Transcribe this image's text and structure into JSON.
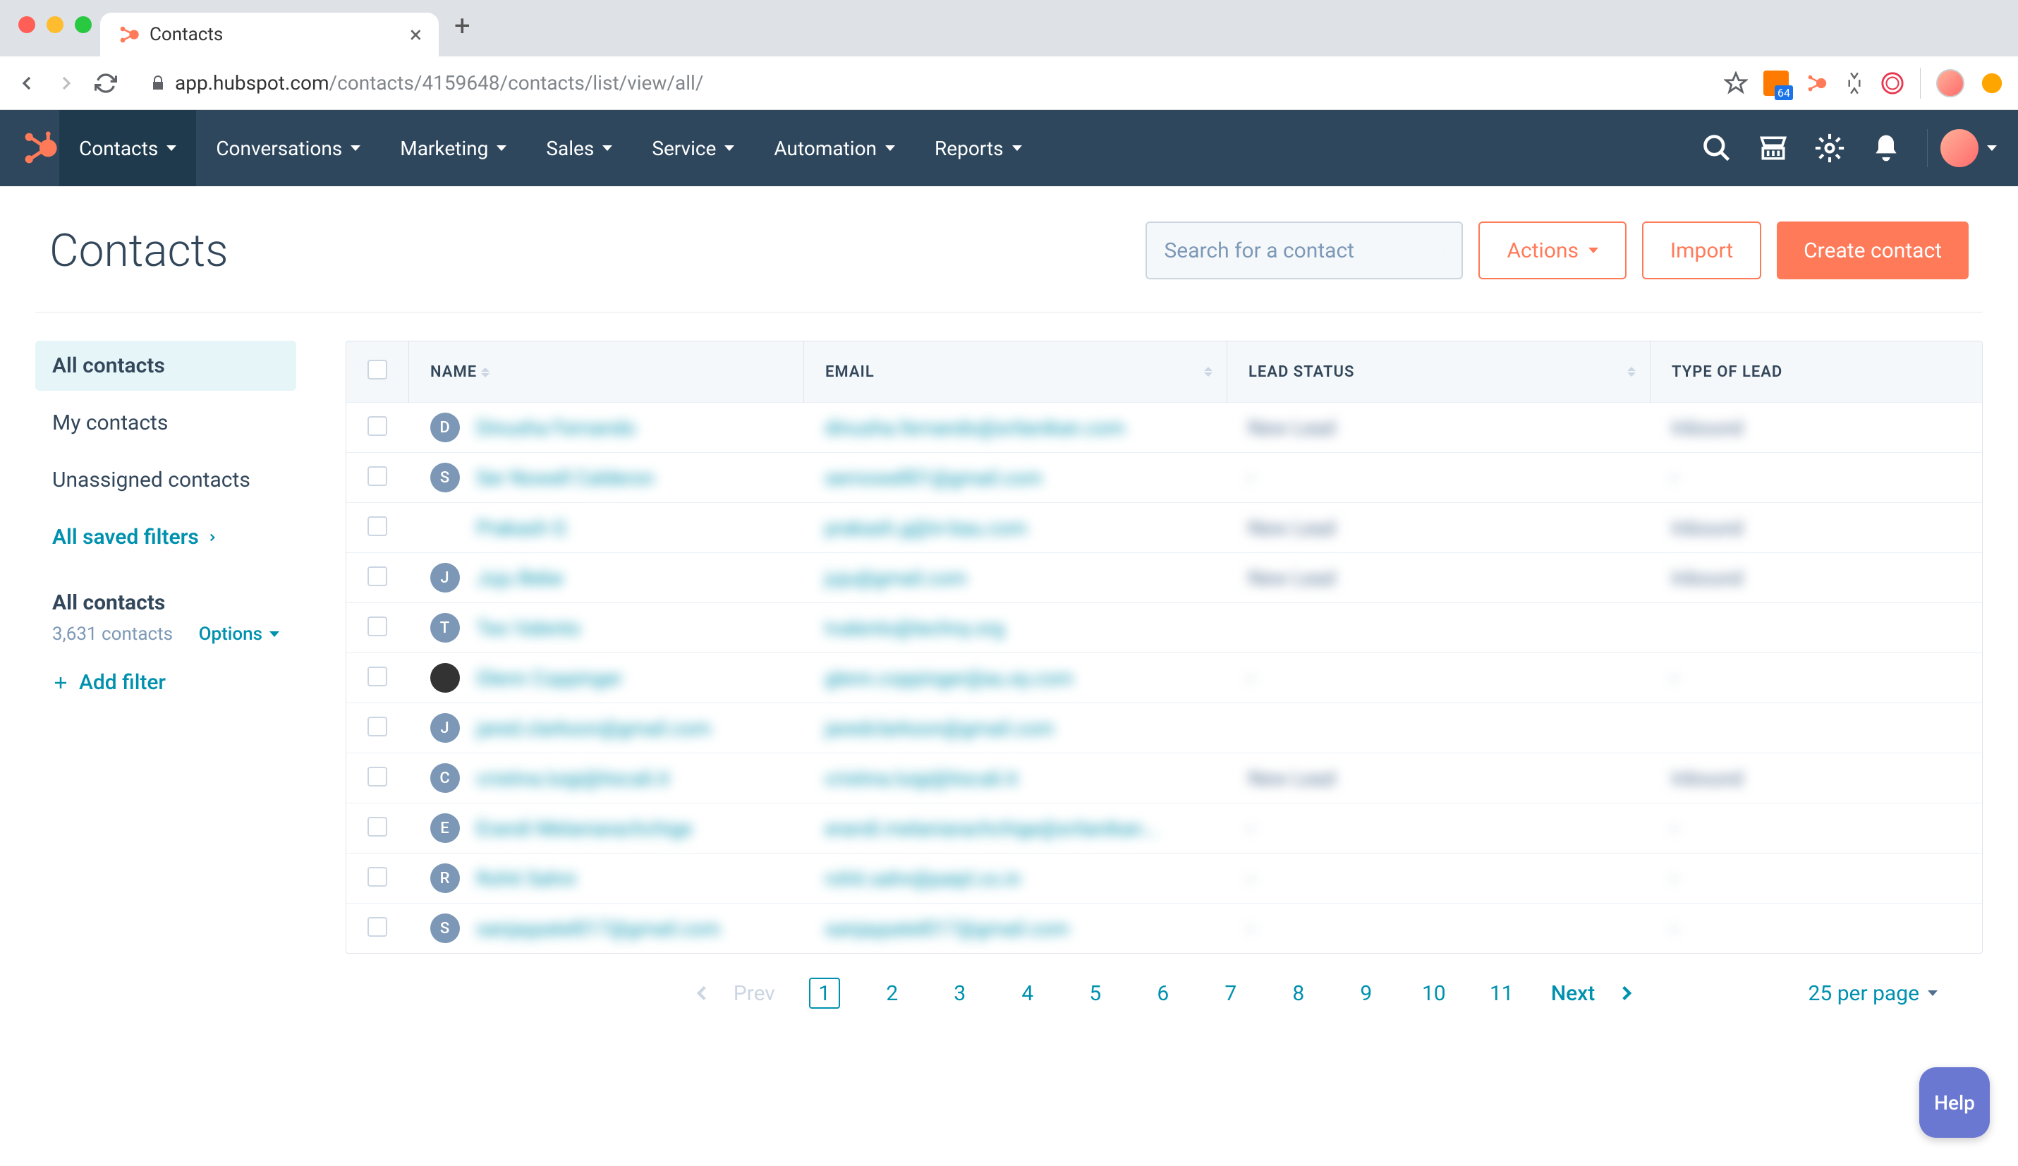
{
  "browser": {
    "tab_title": "Contacts",
    "url_host": "app.hubspot.com",
    "url_path": "/contacts/4159648/contacts/list/view/all/",
    "badge": "64"
  },
  "nav": {
    "items": [
      {
        "label": "Contacts",
        "active": true
      },
      {
        "label": "Conversations"
      },
      {
        "label": "Marketing"
      },
      {
        "label": "Sales"
      },
      {
        "label": "Service"
      },
      {
        "label": "Automation"
      },
      {
        "label": "Reports"
      }
    ]
  },
  "header": {
    "title": "Contacts",
    "search_placeholder": "Search for a contact",
    "actions_label": "Actions",
    "import_label": "Import",
    "create_label": "Create contact"
  },
  "sidebar": {
    "views": [
      {
        "label": "All contacts",
        "active": true
      },
      {
        "label": "My contacts"
      },
      {
        "label": "Unassigned contacts"
      }
    ],
    "saved_filters_label": "All saved filters",
    "current_title": "All contacts",
    "count_text": "3,631 contacts",
    "options_label": "Options",
    "add_filter_label": "Add filter"
  },
  "table": {
    "columns": [
      "NAME",
      "EMAIL",
      "LEAD STATUS",
      "TYPE OF LEAD"
    ],
    "rows": [
      {
        "initial": "D",
        "color": "#7c98b6",
        "name": "Dinusha Fernando",
        "email": "dinusha.fernando@srilanikan.com",
        "status": "New Lead",
        "type": "Inbound"
      },
      {
        "initial": "S",
        "color": "#7c98b6",
        "name": "Ser Nowell Calderon",
        "email": "sernowell01@gmail.com",
        "status": "-",
        "type": "-"
      },
      {
        "initial": "",
        "color": "#fff",
        "name": "Prakash G",
        "email": "prakash.g@in-bau.com",
        "status": "New Lead",
        "type": "Inbound"
      },
      {
        "initial": "J",
        "color": "#7c98b6",
        "name": "Juju Bebe",
        "email": "juju@gmail.com",
        "status": "New Lead",
        "type": "Inbound"
      },
      {
        "initial": "T",
        "color": "#7c98b6",
        "name": "Teo Valento",
        "email": "tvalento@techny.org",
        "status": "",
        "type": ""
      },
      {
        "initial": "",
        "color": "#333",
        "name": "Glenn Coppinger",
        "email": "glenn.coppinger@au.ey.com",
        "status": "-",
        "type": "-"
      },
      {
        "initial": "J",
        "color": "#7c98b6",
        "name": "jared.clarkson@gmail.com",
        "email": "jaredclarkson@gmail.com",
        "status": "",
        "type": ""
      },
      {
        "initial": "C",
        "color": "#7c98b6",
        "name": "cristina.luigi@tiscali.it",
        "email": "cristina.luigi@tiscali.it",
        "status": "New Lead",
        "type": "Inbound"
      },
      {
        "initial": "E",
        "color": "#7c98b6",
        "name": "Erandi Melaniarachchige",
        "email": "erandi.melaniarachchige@srilanikan...",
        "status": "-",
        "type": "-"
      },
      {
        "initial": "R",
        "color": "#7c98b6",
        "name": "Rohit Sahni",
        "email": "rohit.sahn@paipl.co.in",
        "status": "-",
        "type": "-"
      },
      {
        "initial": "S",
        "color": "#7c98b6",
        "name": "sanjaypatel017@gmail.com",
        "email": "sanjaypatel017@gmail.com",
        "status": "-",
        "type": "-"
      }
    ]
  },
  "pagination": {
    "prev": "Prev",
    "next": "Next",
    "pages": [
      "1",
      "2",
      "3",
      "4",
      "5",
      "6",
      "7",
      "8",
      "9",
      "10",
      "11"
    ],
    "current": "1",
    "per_page": "25 per page"
  },
  "help": "Help"
}
